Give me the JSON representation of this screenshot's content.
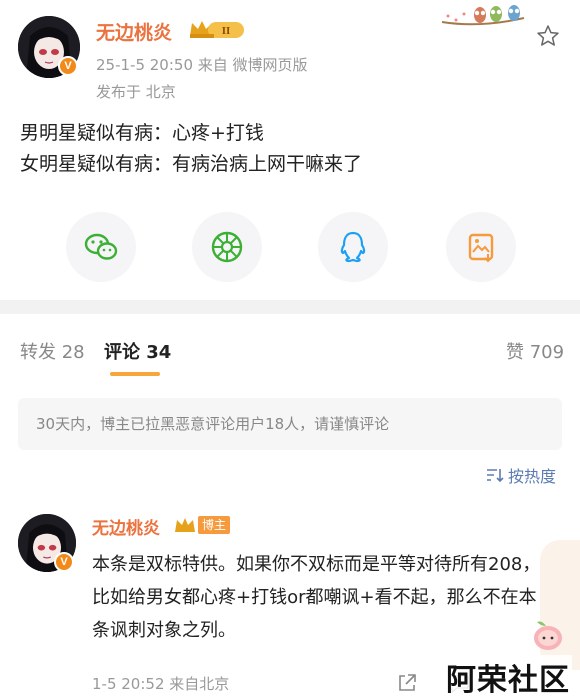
{
  "post": {
    "author": "无边桃炎",
    "level_badge": "II",
    "time_source": "25-1-5 20:50  来自 微博网页版",
    "location": "发布于 北京",
    "lines": [
      "男明星疑似有病：心疼+打钱",
      "女明星疑似有病：有病治病上网干嘛来了"
    ]
  },
  "share": [
    {
      "name": "wechat",
      "color": "#3cb034"
    },
    {
      "name": "moments",
      "color": "#3cb034"
    },
    {
      "name": "qq",
      "color": "#1ea0f2"
    },
    {
      "name": "save-image",
      "color": "#f59a3d"
    }
  ],
  "tabs": {
    "repost": "转发 28",
    "comment": "评论 34",
    "like": "赞 709"
  },
  "notice": "30天内，博主已拉黑恶意评论用户18人，请谨慎评论",
  "sort_label": "按热度",
  "comment": {
    "author": "无边桃炎",
    "badge": "博主",
    "text": "本条是双标特供。如果你不双标而是平等对待所有208，比如给男女都心疼+打钱or都嘲讽+看不起，那么不在本条讽刺对象之列。",
    "time": "1-5 20:52  来自北京"
  },
  "watermark": "阿荣社区",
  "colors": {
    "name": "#eb7340",
    "accent": "#f7a63a",
    "link": "#5b7bb3"
  }
}
